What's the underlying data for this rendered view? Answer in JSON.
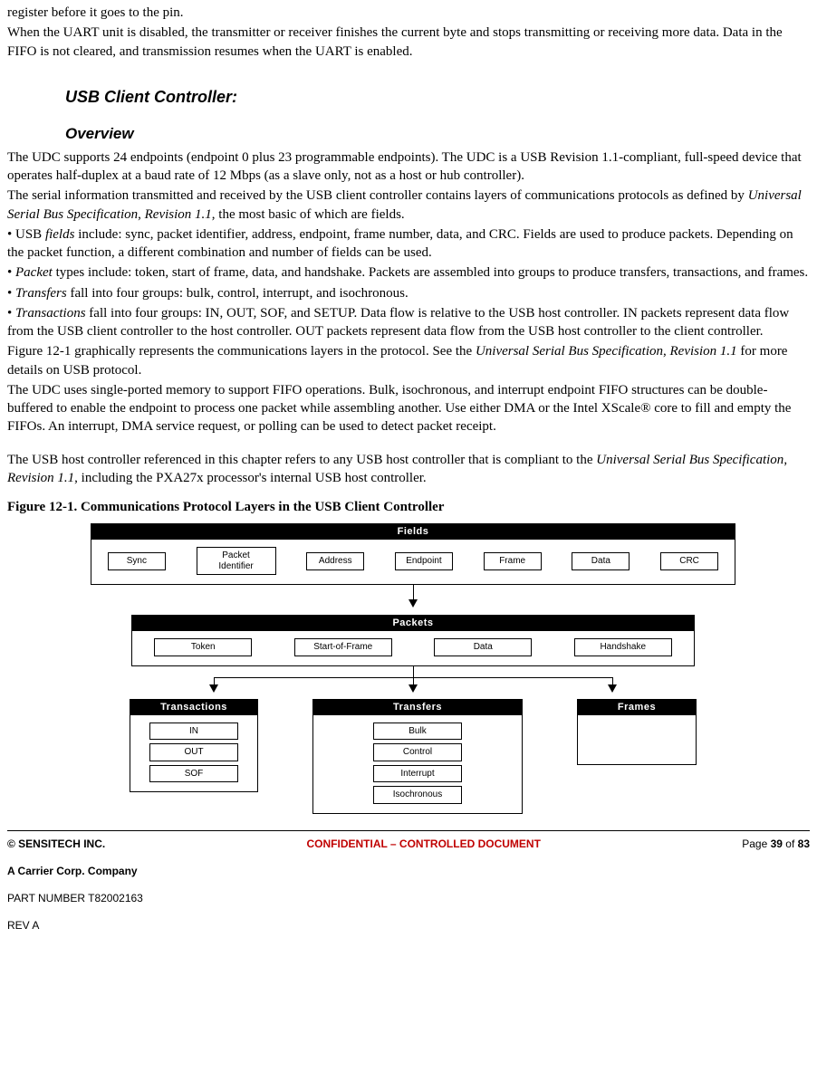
{
  "intro": {
    "p0": "register before it goes to the pin.",
    "p1": "When the UART unit is disabled, the transmitter or receiver finishes the current byte and stops transmitting or receiving more data. Data in the FIFO is not cleared, and transmission resumes when the UART is enabled."
  },
  "headings": {
    "usb_client": "USB Client Controller:",
    "overview": "Overview"
  },
  "body": {
    "p2a": "The UDC supports 24 endpoints (endpoint 0 plus 23 programmable endpoints). The UDC is a USB Revision 1.1-compliant, full-speed device that operates half-duplex at a baud rate of 12 Mbps (as a slave only, not as a host or hub controller).",
    "p2b_pre": "The serial information transmitted and received by the USB client controller contains layers of communications protocols as defined by ",
    "p2b_em": "Universal Serial Bus Specification",
    "p2b_mid": ", ",
    "p2b_em2": "Revision 1.1",
    "p2b_post": ", the most basic of which are fields.",
    "b1_pre": "• USB ",
    "b1_em": "fields",
    "b1_post": " include: sync, packet identifier, address, endpoint, frame number, data, and CRC. Fields are used to produce packets. Depending on the packet function, a different combination and number of fields can be used.",
    "b2_pre": "• ",
    "b2_em": "Packet",
    "b2_post": " types include: token, start of frame, data, and handshake. Packets are assembled into groups to produce transfers, transactions, and frames.",
    "b3_pre": "• ",
    "b3_em": "Transfers",
    "b3_post": " fall into four groups: bulk, control, interrupt, and isochronous.",
    "b4_pre": "• ",
    "b4_em": "Transactions",
    "b4_post": " fall into four groups: IN, OUT, SOF, and SETUP. Data flow is relative to the USB host controller. IN packets represent data flow from the USB client controller to the host controller. OUT packets represent data flow from the USB host controller to the client controller.",
    "p3_pre": "Figure 12-1 graphically represents the communications layers in the protocol. See the ",
    "p3_em": "Universal Serial Bus Specification",
    "p3_mid": ", ",
    "p3_em2": "Revision 1.1",
    "p3_post": " for more details on USB protocol.",
    "p4": "The UDC uses single-ported memory to support FIFO operations. Bulk, isochronous, and interrupt endpoint FIFO structures can be double-buffered to enable the endpoint to process one packet while assembling another. Use either DMA or the Intel XScale® core to fill and empty the FIFOs. An interrupt, DMA service request, or polling can be used to detect packet receipt.",
    "p5_pre": "The USB host controller referenced in this chapter refers to any USB host controller that is compliant to the ",
    "p5_em": "Universal Serial Bus Specification",
    "p5_mid": ", ",
    "p5_em2": "Revision 1.1",
    "p5_post": ", including the PXA27x processor's internal USB host controller."
  },
  "figure": {
    "caption": "Figure 12-1. Communications Protocol Layers in the USB Client Controller",
    "fields": {
      "title": "Fields",
      "items": [
        "Sync",
        "Packet Identifier",
        "Address",
        "Endpoint",
        "Frame",
        "Data",
        "CRC"
      ]
    },
    "packets": {
      "title": "Packets",
      "items": [
        "Token",
        "Start-of-Frame",
        "Data",
        "Handshake"
      ]
    },
    "transactions": {
      "title": "Transactions",
      "items": [
        "IN",
        "OUT",
        "SOF"
      ]
    },
    "transfers": {
      "title": "Transfers",
      "items": [
        "Bulk",
        "Control",
        "Interrupt",
        "Isochronous"
      ]
    },
    "frames": {
      "title": "Frames"
    }
  },
  "footer": {
    "left": "© SENSITECH INC.",
    "mid": "CONFIDENTIAL – CONTROLLED DOCUMENT",
    "right_pre": "Page ",
    "right_cur": "39",
    "right_mid": " of ",
    "right_tot": "83",
    "company": "A Carrier Corp. Company",
    "part": "PART NUMBER T82002163",
    "rev": "REV A"
  }
}
